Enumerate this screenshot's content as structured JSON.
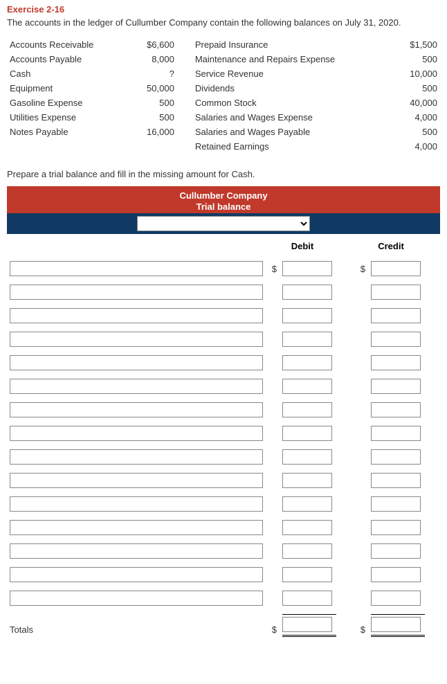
{
  "exercise": {
    "title": "Exercise 2-16",
    "intro": "The accounts in the ledger of Cullumber Company contain the following balances on July 31, 2020."
  },
  "balances": {
    "left": [
      {
        "name": "Accounts Receivable",
        "amount": "$6,600"
      },
      {
        "name": "Accounts Payable",
        "amount": "8,000"
      },
      {
        "name": "Cash",
        "amount": "?"
      },
      {
        "name": "Equipment",
        "amount": "50,000"
      },
      {
        "name": "Gasoline Expense",
        "amount": "500"
      },
      {
        "name": "Utilities Expense",
        "amount": "500"
      },
      {
        "name": "Notes Payable",
        "amount": "16,000"
      }
    ],
    "right": [
      {
        "name": "Prepaid Insurance",
        "amount": "$1,500"
      },
      {
        "name": "Maintenance and Repairs Expense",
        "amount": "500"
      },
      {
        "name": "Service Revenue",
        "amount": "10,000"
      },
      {
        "name": "Dividends",
        "amount": "500"
      },
      {
        "name": "Common Stock",
        "amount": "40,000"
      },
      {
        "name": "Salaries and Wages Expense",
        "amount": "4,000"
      },
      {
        "name": "Salaries and Wages Payable",
        "amount": "500"
      },
      {
        "name": "Retained Earnings",
        "amount": "4,000"
      }
    ]
  },
  "instructions": "Prepare a trial balance and fill in the missing amount for Cash.",
  "trial_balance": {
    "company": "Cullumber Company",
    "subtitle": "Trial balance",
    "columns": {
      "debit": "Debit",
      "credit": "Credit"
    },
    "currency": "$",
    "totals_label": "Totals"
  }
}
